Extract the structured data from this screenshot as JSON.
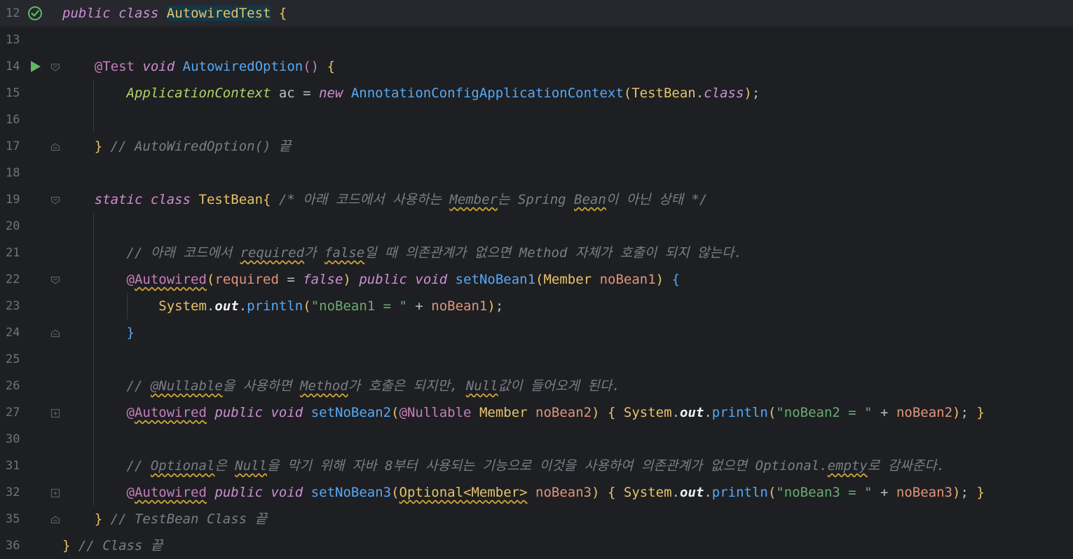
{
  "editor": {
    "lines": [
      {
        "n": "12",
        "tokens": [
          [
            "kw",
            "public"
          ],
          [
            "plain",
            " "
          ],
          [
            "kw",
            "class"
          ],
          [
            "plain",
            " "
          ],
          [
            "cls hl",
            "AutowiredTest"
          ],
          [
            "plain",
            " "
          ],
          [
            "brk1",
            "{"
          ]
        ]
      },
      {
        "n": "13",
        "tokens": []
      },
      {
        "n": "14",
        "tokens": [
          [
            "plain",
            "    "
          ],
          [
            "ann",
            "@Test"
          ],
          [
            "plain",
            " "
          ],
          [
            "kw",
            "void"
          ],
          [
            "plain",
            " "
          ],
          [
            "meth",
            "AutowiredOption"
          ],
          [
            "brk2",
            "()"
          ],
          [
            "plain",
            " "
          ],
          [
            "brk1",
            "{"
          ]
        ]
      },
      {
        "n": "15",
        "tokens": [
          [
            "plain",
            "        "
          ],
          [
            "clsg",
            "ApplicationContext"
          ],
          [
            "plain",
            " ac = "
          ],
          [
            "kw",
            "new"
          ],
          [
            "plain",
            " "
          ],
          [
            "meth",
            "AnnotationConfigApplicationContext"
          ],
          [
            "brk1",
            "("
          ],
          [
            "cls",
            "TestBean"
          ],
          [
            "plain",
            "."
          ],
          [
            "kw",
            "class"
          ],
          [
            "brk1",
            ")"
          ],
          [
            "plain",
            ";"
          ]
        ]
      },
      {
        "n": "16",
        "tokens": []
      },
      {
        "n": "17",
        "tokens": [
          [
            "plain",
            "    "
          ],
          [
            "brk1",
            "}"
          ],
          [
            "plain",
            " "
          ],
          [
            "cmt",
            "// AutoWiredOption() 끝"
          ]
        ]
      },
      {
        "n": "18",
        "tokens": []
      },
      {
        "n": "19",
        "tokens": [
          [
            "plain",
            "    "
          ],
          [
            "kw",
            "static"
          ],
          [
            "plain",
            " "
          ],
          [
            "kw",
            "class"
          ],
          [
            "plain",
            " "
          ],
          [
            "cls",
            "TestBean"
          ],
          [
            "brk1",
            "{"
          ],
          [
            "plain",
            " "
          ],
          [
            "cmt",
            "/* 아래 코드에서 사용하는 "
          ],
          [
            "cmt squig",
            "Member"
          ],
          [
            "cmt",
            "는 Spring "
          ],
          [
            "cmt squig",
            "Bean"
          ],
          [
            "cmt",
            "이 아닌 상태 */"
          ]
        ]
      },
      {
        "n": "20",
        "tokens": []
      },
      {
        "n": "21",
        "tokens": [
          [
            "plain",
            "        "
          ],
          [
            "cmt",
            "// 아래 코드에서 "
          ],
          [
            "cmt squig",
            "required"
          ],
          [
            "cmt",
            "가 "
          ],
          [
            "cmt squig",
            "false"
          ],
          [
            "cmt",
            "일 때 의존관계가 없으면 Method 자체가 호출이 되지 않는다."
          ]
        ]
      },
      {
        "n": "22",
        "tokens": [
          [
            "plain",
            "        "
          ],
          [
            "ann",
            "@"
          ],
          [
            "ann squig",
            "Autowired"
          ],
          [
            "brk1",
            "("
          ],
          [
            "param",
            "required"
          ],
          [
            "plain",
            " = "
          ],
          [
            "kw",
            "false"
          ],
          [
            "brk1",
            ")"
          ],
          [
            "plain",
            " "
          ],
          [
            "kw",
            "public"
          ],
          [
            "plain",
            " "
          ],
          [
            "kw",
            "void"
          ],
          [
            "plain",
            " "
          ],
          [
            "meth",
            "setNoBean1"
          ],
          [
            "brk1",
            "("
          ],
          [
            "cls",
            "Member"
          ],
          [
            "plain",
            " "
          ],
          [
            "param",
            "noBean1"
          ],
          [
            "brk1",
            ")"
          ],
          [
            "plain",
            " "
          ],
          [
            "brk3",
            "{"
          ]
        ]
      },
      {
        "n": "23",
        "tokens": [
          [
            "plain",
            "            "
          ],
          [
            "cls",
            "System"
          ],
          [
            "plain",
            "."
          ],
          [
            "out",
            "out"
          ],
          [
            "plain",
            "."
          ],
          [
            "meth",
            "println"
          ],
          [
            "brk1",
            "("
          ],
          [
            "str",
            "\"noBean1 = \""
          ],
          [
            "plain",
            " + "
          ],
          [
            "param",
            "noBean1"
          ],
          [
            "brk1",
            ")"
          ],
          [
            "plain",
            ";"
          ]
        ]
      },
      {
        "n": "24",
        "tokens": [
          [
            "plain",
            "        "
          ],
          [
            "brk3",
            "}"
          ]
        ]
      },
      {
        "n": "25",
        "tokens": []
      },
      {
        "n": "26",
        "tokens": [
          [
            "plain",
            "        "
          ],
          [
            "cmt",
            "// "
          ],
          [
            "cmt squig",
            "@Nullable"
          ],
          [
            "cmt",
            "을 사용하면 "
          ],
          [
            "cmt squig",
            "Method"
          ],
          [
            "cmt",
            "가 호출은 되지만, "
          ],
          [
            "cmt squig",
            "Null"
          ],
          [
            "cmt",
            "값이 들어오게 된다."
          ]
        ]
      },
      {
        "n": "27",
        "tokens": [
          [
            "plain",
            "        "
          ],
          [
            "ann",
            "@"
          ],
          [
            "ann squig",
            "Autowired"
          ],
          [
            "plain",
            " "
          ],
          [
            "kw",
            "public"
          ],
          [
            "plain",
            " "
          ],
          [
            "kw",
            "void"
          ],
          [
            "plain",
            " "
          ],
          [
            "meth",
            "setNoBean2"
          ],
          [
            "brk1",
            "("
          ],
          [
            "ann",
            "@Nullable"
          ],
          [
            "plain",
            " "
          ],
          [
            "cls",
            "Member"
          ],
          [
            "plain",
            " "
          ],
          [
            "param",
            "noBean2"
          ],
          [
            "brk1",
            ")"
          ],
          [
            "plain",
            " "
          ],
          [
            "brk1",
            "{"
          ],
          [
            "plain",
            " "
          ],
          [
            "cls",
            "System"
          ],
          [
            "plain",
            "."
          ],
          [
            "out",
            "out"
          ],
          [
            "plain",
            "."
          ],
          [
            "meth",
            "println"
          ],
          [
            "brk1",
            "("
          ],
          [
            "str",
            "\"noBean2 = \""
          ],
          [
            "plain",
            " + "
          ],
          [
            "param",
            "noBean2"
          ],
          [
            "brk1",
            ")"
          ],
          [
            "plain",
            "; "
          ],
          [
            "brk1",
            "}"
          ]
        ]
      },
      {
        "n": "30",
        "tokens": []
      },
      {
        "n": "31",
        "tokens": [
          [
            "plain",
            "        "
          ],
          [
            "cmt",
            "// "
          ],
          [
            "cmt squig",
            "Optional"
          ],
          [
            "cmt",
            "은 "
          ],
          [
            "cmt squig",
            "Null"
          ],
          [
            "cmt",
            "을 막기 위해 자바 8부터 사용되는 기능으로 이것을 사용하여 의존관계가 없으면 Optional."
          ],
          [
            "cmt squig",
            "empty"
          ],
          [
            "cmt",
            "로 감싸준다."
          ]
        ]
      },
      {
        "n": "32",
        "tokens": [
          [
            "plain",
            "        "
          ],
          [
            "ann",
            "@"
          ],
          [
            "ann squig",
            "Autowired"
          ],
          [
            "plain",
            " "
          ],
          [
            "kw",
            "public"
          ],
          [
            "plain",
            " "
          ],
          [
            "kw",
            "void"
          ],
          [
            "plain",
            " "
          ],
          [
            "meth",
            "setNoBean3"
          ],
          [
            "brk1",
            "("
          ],
          [
            "cls squig",
            "Optional<Member>"
          ],
          [
            "plain",
            " "
          ],
          [
            "param",
            "noBean3"
          ],
          [
            "brk1",
            ")"
          ],
          [
            "plain",
            " "
          ],
          [
            "brk1",
            "{"
          ],
          [
            "plain",
            " "
          ],
          [
            "cls",
            "System"
          ],
          [
            "plain",
            "."
          ],
          [
            "out",
            "out"
          ],
          [
            "plain",
            "."
          ],
          [
            "meth",
            "println"
          ],
          [
            "brk1",
            "("
          ],
          [
            "str",
            "\"noBean3 = \""
          ],
          [
            "plain",
            " + "
          ],
          [
            "param",
            "noBean3"
          ],
          [
            "brk1",
            ")"
          ],
          [
            "plain",
            "; "
          ],
          [
            "brk1",
            "}"
          ]
        ]
      },
      {
        "n": "35",
        "tokens": [
          [
            "plain",
            "    "
          ],
          [
            "brk1",
            "}"
          ],
          [
            "plain",
            " "
          ],
          [
            "cmt",
            "// TestBean Class 끝"
          ]
        ]
      },
      {
        "n": "36",
        "tokens": [
          [
            "brk1",
            "}"
          ],
          [
            "plain",
            " "
          ],
          [
            "cmt",
            "// Class 끝"
          ]
        ]
      }
    ]
  },
  "colors": {
    "background": "#1e1f22",
    "current_line": "#26282e",
    "run_icon": "#5fb865",
    "check_icon": "#5fb865"
  },
  "gutter_icons": {
    "12": "test-passed-check-icon",
    "14": "run-test-icon"
  }
}
